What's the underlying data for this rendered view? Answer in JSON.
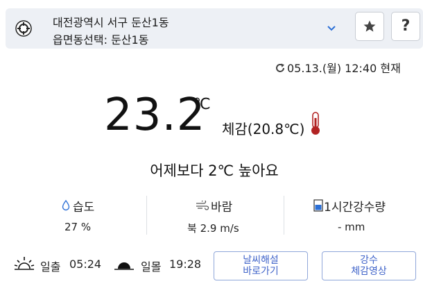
{
  "location": {
    "line1": "대전광역시 서구 둔산1동",
    "line2": "읍면동선택: 둔산1동"
  },
  "header_buttons": {
    "favorite_icon": "star-icon",
    "help_label": "?"
  },
  "timestamp": "05.13.(월) 12:40 현재",
  "current": {
    "temperature": "23.2",
    "unit": "℃",
    "feels_like": "체감(20.8℃)",
    "compare_yesterday": "어제보다 2℃ 높아요"
  },
  "stats": {
    "humidity": {
      "label": "습도",
      "value": "27 %",
      "icon": "droplet-icon"
    },
    "wind": {
      "label": "바람",
      "value": "북 2.9 m/s",
      "icon": "wind-icon"
    },
    "rain": {
      "label": "1시간강수량",
      "value": "- mm",
      "icon": "rain-gauge-icon"
    }
  },
  "sun": {
    "sunrise_label": "일출",
    "sunrise_time": "05:24",
    "sunset_label": "일몰",
    "sunset_time": "19:28"
  },
  "buttons": {
    "weather_explain": [
      "날씨해설",
      "바로가기"
    ],
    "rain_video": [
      "강수",
      "체감영상"
    ]
  },
  "colors": {
    "accent": "#3f63c9",
    "thermometer": "#b22222",
    "location_bg": "#edf0f5"
  }
}
